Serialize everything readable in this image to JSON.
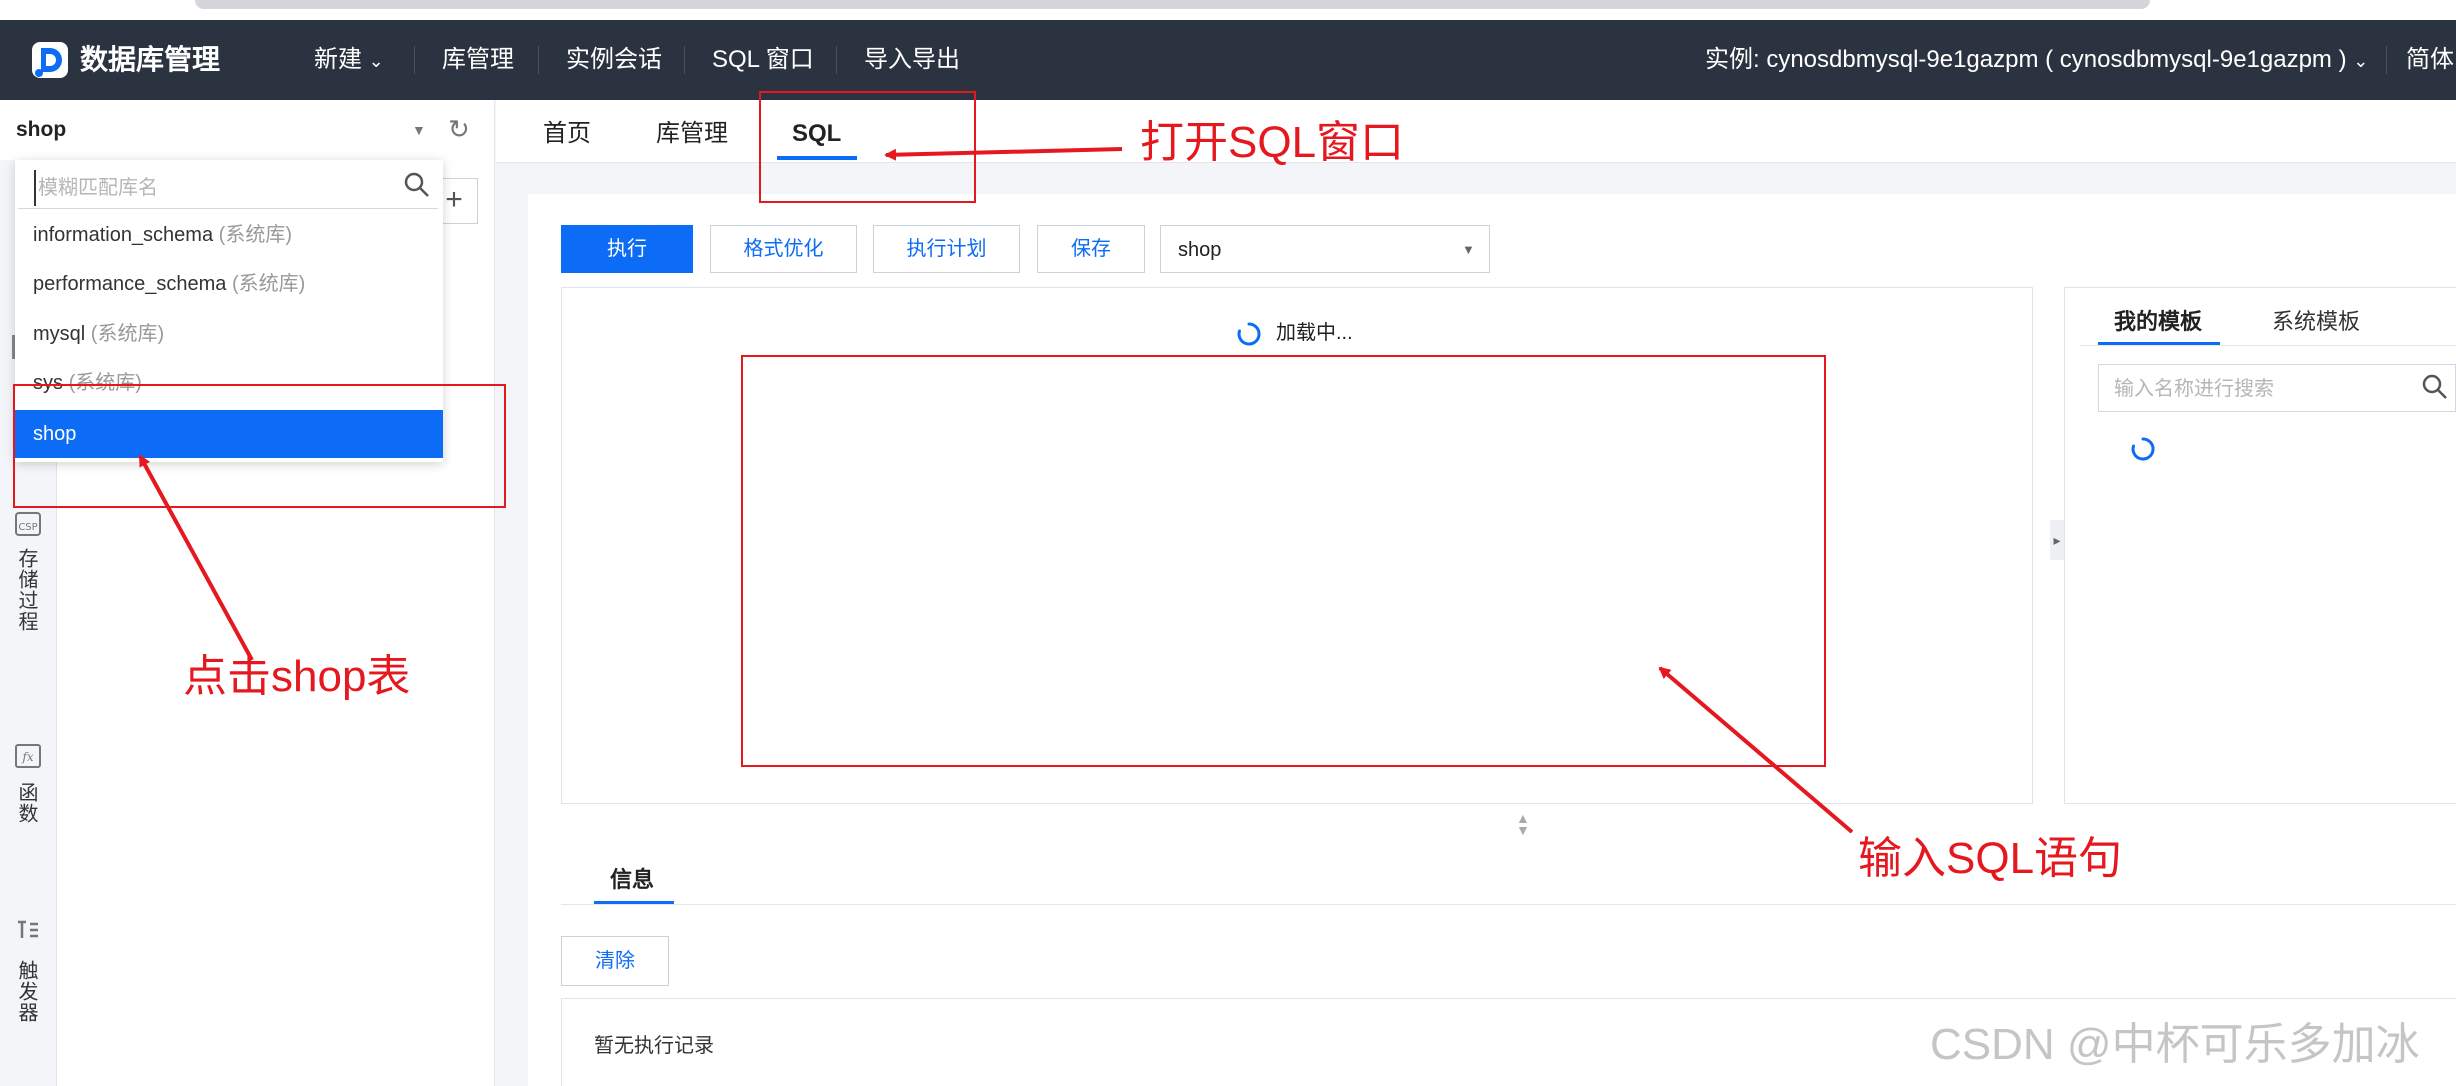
{
  "topnav": {
    "logo": "数据库管理",
    "menu": [
      "新建",
      "库管理",
      "实例会话",
      "SQL 窗口",
      "导入导出"
    ],
    "instance": "实例: cynosdbmysql-9e1gazpm ( cynosdbmysql-9e1gazpm )",
    "lang": "简体"
  },
  "sidebar": {
    "selected_db": "shop",
    "rail": [
      {
        "icon": "stored-procedure-icon",
        "label": "存储过程"
      },
      {
        "icon": "function-icon",
        "label": "函数"
      },
      {
        "icon": "trigger-icon",
        "label": "触发器"
      }
    ]
  },
  "dropdown": {
    "placeholder": "模糊匹配库名",
    "items": [
      {
        "name": "information_schema",
        "note": "(系统库)"
      },
      {
        "name": "performance_schema",
        "note": "(系统库)"
      },
      {
        "name": "mysql",
        "note": "(系统库)"
      },
      {
        "name": "sys",
        "note": "(系统库)"
      },
      {
        "name": "shop",
        "note": ""
      }
    ],
    "selected": "shop"
  },
  "tabs": [
    "首页",
    "库管理",
    "SQL"
  ],
  "active_tab": "SQL",
  "toolbar": {
    "run": "执行",
    "format": "格式优化",
    "plan": "执行计划",
    "save": "保存",
    "db": "shop"
  },
  "editor": {
    "loading": "加载中..."
  },
  "templates": {
    "tab_mine": "我的模板",
    "tab_system": "系统模板",
    "search_placeholder": "输入名称进行搜索"
  },
  "info": {
    "tab": "信息",
    "clear": "清除",
    "empty": "暂无执行记录"
  },
  "annotations": {
    "open_sql": "打开SQL窗口",
    "click_shop": "点击shop表",
    "input_sql": "输入SQL语句",
    "color": "#e5181f"
  },
  "watermark": "CSDN @中杯可乐多加冰",
  "colors": {
    "nav_bg": "#2b3340",
    "accent": "#0c6cf5"
  }
}
